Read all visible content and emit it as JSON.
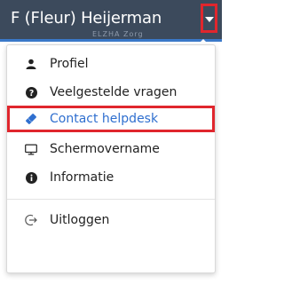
{
  "header": {
    "user_name": "F (Fleur) Heijerman",
    "user_subtitle": "ELZHA Zorg"
  },
  "menu": {
    "items": [
      {
        "label": "Profiel",
        "icon": "user-icon"
      },
      {
        "label": "Veelgestelde vragen",
        "icon": "question-circle-icon"
      },
      {
        "label": "Contact helpdesk",
        "icon": "ticket-icon"
      },
      {
        "label": "Schermovername",
        "icon": "monitor-icon"
      },
      {
        "label": "Informatie",
        "icon": "info-circle-icon"
      },
      {
        "label": "Uitloggen",
        "icon": "logout-icon"
      }
    ]
  },
  "colors": {
    "header_bg": "#3c4a5c",
    "accent_blue": "#2f6fcf",
    "highlight_red": "#e0262d"
  }
}
